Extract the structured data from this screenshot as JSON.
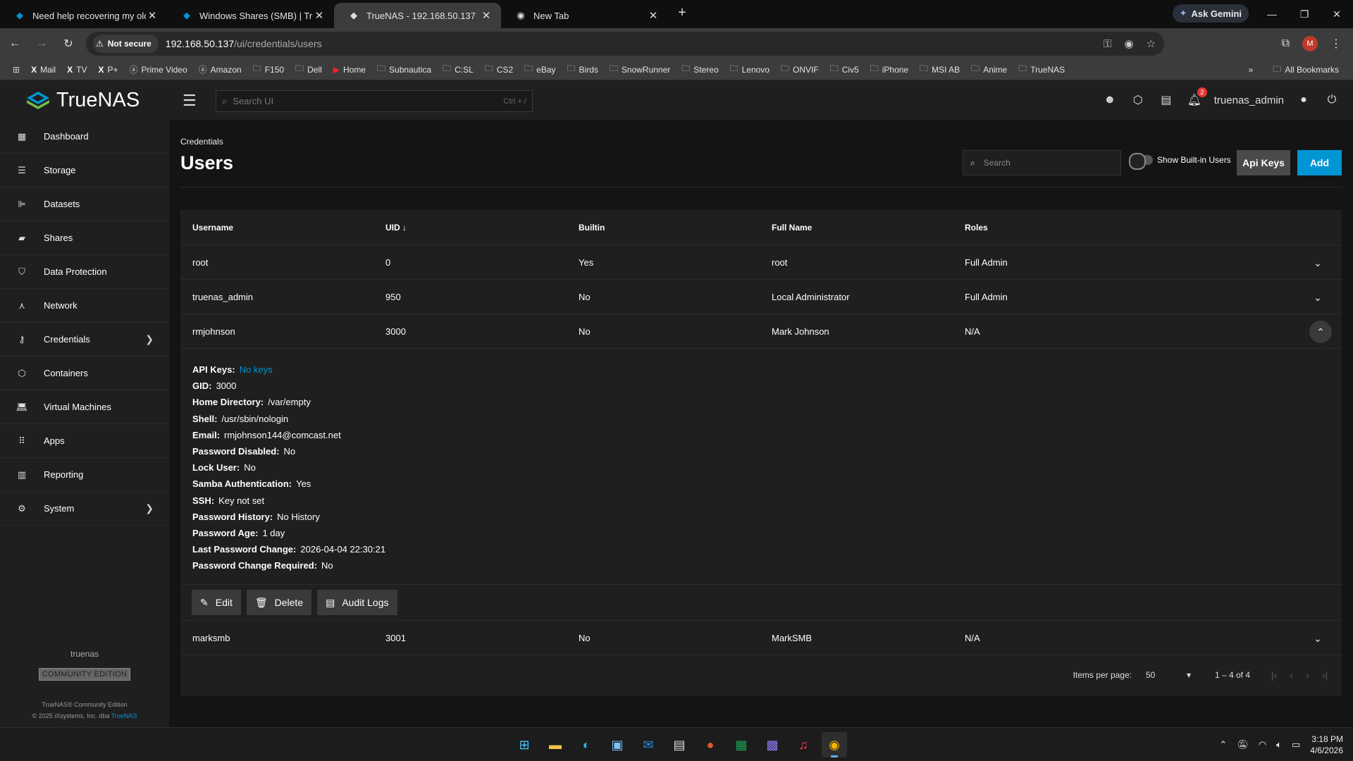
{
  "browser": {
    "tabs": [
      {
        "title": "Need help recovering my old Tr",
        "active": false
      },
      {
        "title": "Windows Shares (SMB) | TrueN",
        "active": false
      },
      {
        "title": "TrueNAS - 192.168.50.137",
        "active": true
      },
      {
        "title": "New Tab",
        "active": false
      }
    ],
    "gemini_label": "Ask Gemini",
    "not_secure": "Not secure",
    "url_host": "192.168.50.137",
    "url_path": "/ui/credentials/users",
    "profile_initial": "M",
    "bookmarks": [
      {
        "label": "Mail",
        "icon": "x-icon"
      },
      {
        "label": "TV",
        "icon": "x-icon"
      },
      {
        "label": "P+",
        "icon": "x-icon"
      },
      {
        "label": "Prime Video",
        "icon": "amazon-icon"
      },
      {
        "label": "Amazon",
        "icon": "amazon-icon"
      },
      {
        "label": "F150",
        "icon": "folder-icon"
      },
      {
        "label": "Dell",
        "icon": "folder-icon"
      },
      {
        "label": "Home",
        "icon": "youtube-icon"
      },
      {
        "label": "Subnautica",
        "icon": "folder-icon"
      },
      {
        "label": "C:SL",
        "icon": "folder-icon"
      },
      {
        "label": "CS2",
        "icon": "folder-icon"
      },
      {
        "label": "eBay",
        "icon": "folder-icon"
      },
      {
        "label": "Birds",
        "icon": "folder-icon"
      },
      {
        "label": "SnowRunner",
        "icon": "folder-icon"
      },
      {
        "label": "Stereo",
        "icon": "folder-icon"
      },
      {
        "label": "Lenovo",
        "icon": "folder-icon"
      },
      {
        "label": "ONVIF",
        "icon": "folder-icon"
      },
      {
        "label": "Civ5",
        "icon": "folder-icon"
      },
      {
        "label": "iPhone",
        "icon": "folder-icon"
      },
      {
        "label": "MSI AB",
        "icon": "folder-icon"
      },
      {
        "label": "Anime",
        "icon": "folder-icon"
      },
      {
        "label": "TrueNAS",
        "icon": "folder-icon"
      }
    ],
    "all_bookmarks": "All Bookmarks"
  },
  "header": {
    "logo_text": "TrueNAS",
    "search_placeholder": "Search UI",
    "search_shortcut": "Ctrl + /",
    "notification_count": "2",
    "username": "truenas_admin"
  },
  "sidebar": {
    "items": [
      {
        "label": "Dashboard",
        "icon": "dashboard-icon"
      },
      {
        "label": "Storage",
        "icon": "storage-icon"
      },
      {
        "label": "Datasets",
        "icon": "datasets-icon"
      },
      {
        "label": "Shares",
        "icon": "shares-icon"
      },
      {
        "label": "Data Protection",
        "icon": "shield-icon"
      },
      {
        "label": "Network",
        "icon": "network-icon"
      },
      {
        "label": "Credentials",
        "icon": "key-icon"
      },
      {
        "label": "Containers",
        "icon": "box-icon"
      },
      {
        "label": "Virtual Machines",
        "icon": "laptop-icon"
      },
      {
        "label": "Apps",
        "icon": "apps-grid-icon"
      },
      {
        "label": "Reporting",
        "icon": "chart-icon"
      },
      {
        "label": "System",
        "icon": "gear-icon"
      }
    ],
    "hostname": "truenas",
    "edition": "COMMUNITY EDITION",
    "copyright_line1": "TrueNAS® Community Edition",
    "copyright_line2": "© 2025 iXsystems, Inc. dba",
    "copyright_link": "TrueNAS"
  },
  "page": {
    "breadcrumb": "Credentials",
    "title": "Users",
    "search_placeholder": "Search",
    "toggle_label": "Show Built-in Users",
    "api_keys_label": "Api Keys",
    "add_label": "Add"
  },
  "table": {
    "columns": [
      "Username",
      "UID",
      "Builtin",
      "Full Name",
      "Roles"
    ],
    "rows": [
      {
        "username": "root",
        "uid": "0",
        "builtin": "Yes",
        "full_name": "root",
        "roles": "Full Admin"
      },
      {
        "username": "truenas_admin",
        "uid": "950",
        "builtin": "No",
        "full_name": "Local Administrator",
        "roles": "Full Admin"
      },
      {
        "username": "rmjohnson",
        "uid": "3000",
        "builtin": "No",
        "full_name": "Mark Johnson",
        "roles": "N/A"
      },
      {
        "username": "marksmb",
        "uid": "3001",
        "builtin": "No",
        "full_name": "MarkSMB",
        "roles": "N/A"
      }
    ],
    "details": [
      {
        "key": "API Keys:",
        "value": "No keys"
      },
      {
        "key": "GID:",
        "value": "3000"
      },
      {
        "key": "Home Directory:",
        "value": "/var/empty"
      },
      {
        "key": "Shell:",
        "value": "/usr/sbin/nologin"
      },
      {
        "key": "Email:",
        "value": "rmjohnson144@comcast.net"
      },
      {
        "key": "Password Disabled:",
        "value": "No"
      },
      {
        "key": "Lock User:",
        "value": "No"
      },
      {
        "key": "Samba Authentication:",
        "value": "Yes"
      },
      {
        "key": "SSH:",
        "value": "Key not set"
      },
      {
        "key": "Password History:",
        "value": "No History"
      },
      {
        "key": "Password Age:",
        "value": "1 day"
      },
      {
        "key": "Last Password Change:",
        "value": "2026-04-04 22:30:21"
      },
      {
        "key": "Password Change Required:",
        "value": "No"
      }
    ],
    "actions": {
      "edit": "Edit",
      "delete": "Delete",
      "audit_logs": "Audit Logs"
    },
    "paginator": {
      "items_per_page_label": "Items per page:",
      "items_per_page": "50",
      "range": "1 – 4 of 4"
    }
  },
  "taskbar": {
    "time": "3:18 PM",
    "date": "4/6/2026"
  }
}
